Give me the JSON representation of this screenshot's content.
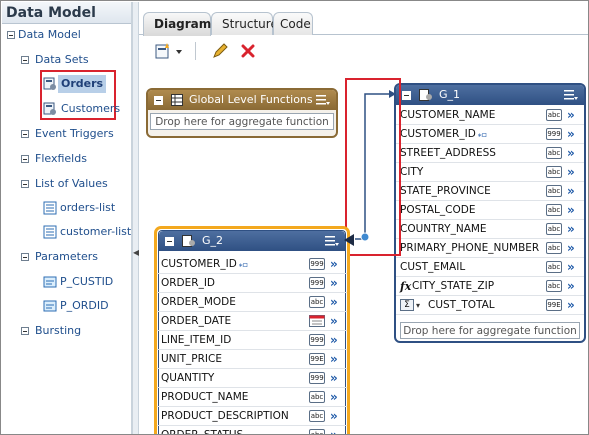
{
  "panel_title": "Data Model",
  "tree": {
    "root": "Data Model",
    "data_sets": "Data Sets",
    "orders": "Orders",
    "customers": "Customers",
    "event_triggers": "Event Triggers",
    "flexfields": "Flexfields",
    "list_of_values": "List of Values",
    "orders_list": "orders-list",
    "customer_list": "customer-list",
    "parameters": "Parameters",
    "p_custid": "P_CUSTID",
    "p_ordid": "P_ORDID",
    "bursting": "Bursting"
  },
  "tabs": {
    "diagram": "Diagram",
    "structure": "Structure",
    "code": "Code"
  },
  "glf": {
    "title": "Global Level Functions",
    "drop": "Drop here for aggregate function"
  },
  "g1": {
    "title": "G_1",
    "rows": [
      {
        "name": "CUSTOMER_NAME",
        "type": "abc"
      },
      {
        "name": "CUSTOMER_ID",
        "type": "999"
      },
      {
        "name": "STREET_ADDRESS",
        "type": "abc"
      },
      {
        "name": "CITY",
        "type": "abc"
      },
      {
        "name": "STATE_PROVINCE",
        "type": "abc"
      },
      {
        "name": "POSTAL_CODE",
        "type": "abc"
      },
      {
        "name": "COUNTRY_NAME",
        "type": "abc"
      },
      {
        "name": "PRIMARY_PHONE_NUMBER",
        "type": "abc"
      },
      {
        "name": "CUST_EMAIL",
        "type": "abc"
      },
      {
        "name": "CITY_STATE_ZIP",
        "type": "abc"
      },
      {
        "name": "CUST_TOTAL",
        "type": "99E"
      }
    ],
    "drop": "Drop here for aggregate function"
  },
  "g2": {
    "title": "G_2",
    "rows": [
      {
        "name": "CUSTOMER_ID",
        "type": "999"
      },
      {
        "name": "ORDER_ID",
        "type": "999"
      },
      {
        "name": "ORDER_MODE",
        "type": "abc"
      },
      {
        "name": "ORDER_DATE",
        "type": "cal"
      },
      {
        "name": "LINE_ITEM_ID",
        "type": "999"
      },
      {
        "name": "UNIT_PRICE",
        "type": "99E"
      },
      {
        "name": "QUANTITY",
        "type": "999"
      },
      {
        "name": "PRODUCT_NAME",
        "type": "abc"
      },
      {
        "name": "PRODUCT_DESCRIPTION",
        "type": "abc"
      },
      {
        "name": "ORDER_STATUS",
        "type": "abc"
      }
    ]
  },
  "colors": {
    "accent_red": "#d9232e",
    "group_blue": "#2f5083",
    "group_brown": "#8a6a35",
    "select_orange": "#f3a81e"
  }
}
